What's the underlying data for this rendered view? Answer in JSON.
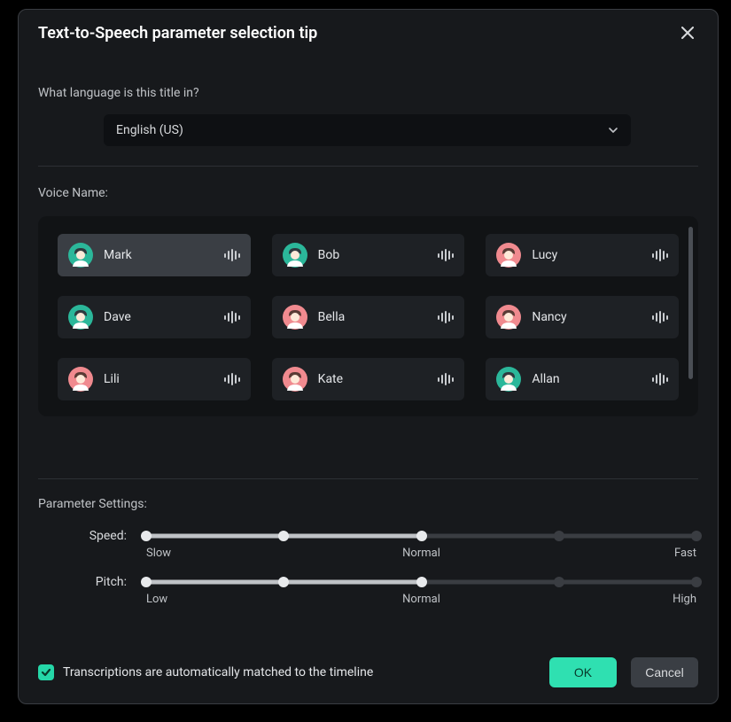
{
  "dialog": {
    "title": "Text-to-Speech parameter selection tip"
  },
  "language": {
    "question": "What language is this title in?",
    "selected": "English (US)"
  },
  "voiceSection": {
    "label": "Voice Name:"
  },
  "voices": [
    {
      "name": "Mark",
      "color": "teal",
      "selected": true
    },
    {
      "name": "Bob",
      "color": "teal",
      "selected": false
    },
    {
      "name": "Lucy",
      "color": "pink",
      "selected": false
    },
    {
      "name": "Dave",
      "color": "teal",
      "selected": false
    },
    {
      "name": "Bella",
      "color": "pink",
      "selected": false
    },
    {
      "name": "Nancy",
      "color": "pink",
      "selected": false
    },
    {
      "name": "Lili",
      "color": "pink",
      "selected": false
    },
    {
      "name": "Kate",
      "color": "pink",
      "selected": false
    },
    {
      "name": "Allan",
      "color": "teal",
      "selected": false
    }
  ],
  "params": {
    "header": "Parameter Settings:",
    "speed": {
      "label": "Speed:",
      "value": 50,
      "ticks": {
        "min": "Slow",
        "mid": "Normal",
        "max": "Fast"
      }
    },
    "pitch": {
      "label": "Pitch:",
      "value": 50,
      "ticks": {
        "min": "Low",
        "mid": "Normal",
        "max": "High"
      }
    }
  },
  "transcription": {
    "checked": true,
    "label": "Transcriptions are automatically matched to the timeline"
  },
  "buttons": {
    "ok": "OK",
    "cancel": "Cancel"
  },
  "colors": {
    "teal": "#2bb79a",
    "pink": "#f08a8f",
    "accent": "#2fe0b1"
  }
}
